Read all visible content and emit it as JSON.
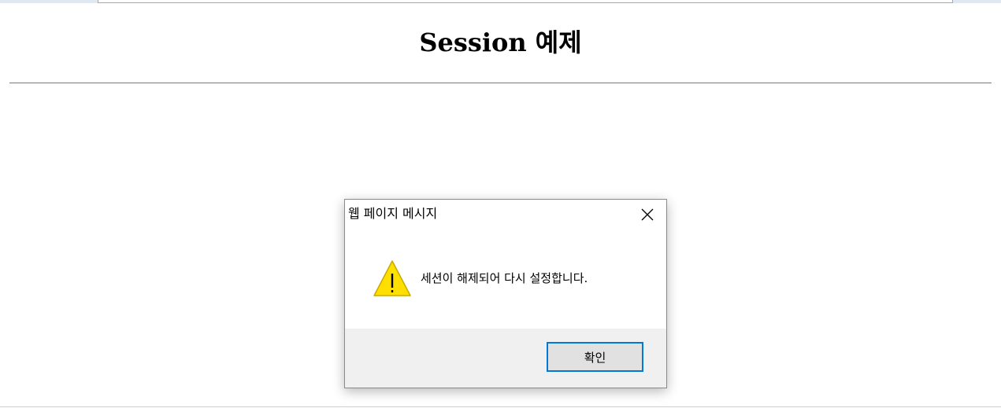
{
  "page": {
    "title": "Session 예제"
  },
  "dialog": {
    "title": "웹 페이지 메시지",
    "message": "세션이 해제되어 다시 설정합니다.",
    "ok_label": "확인",
    "close_icon": "close-icon",
    "warning_icon": "warning-icon"
  },
  "colors": {
    "warning_fill": "#ffdf00",
    "warning_border": "#c9a800",
    "focus_border": "#0078d7",
    "footer_bg": "#f0f0f0"
  }
}
